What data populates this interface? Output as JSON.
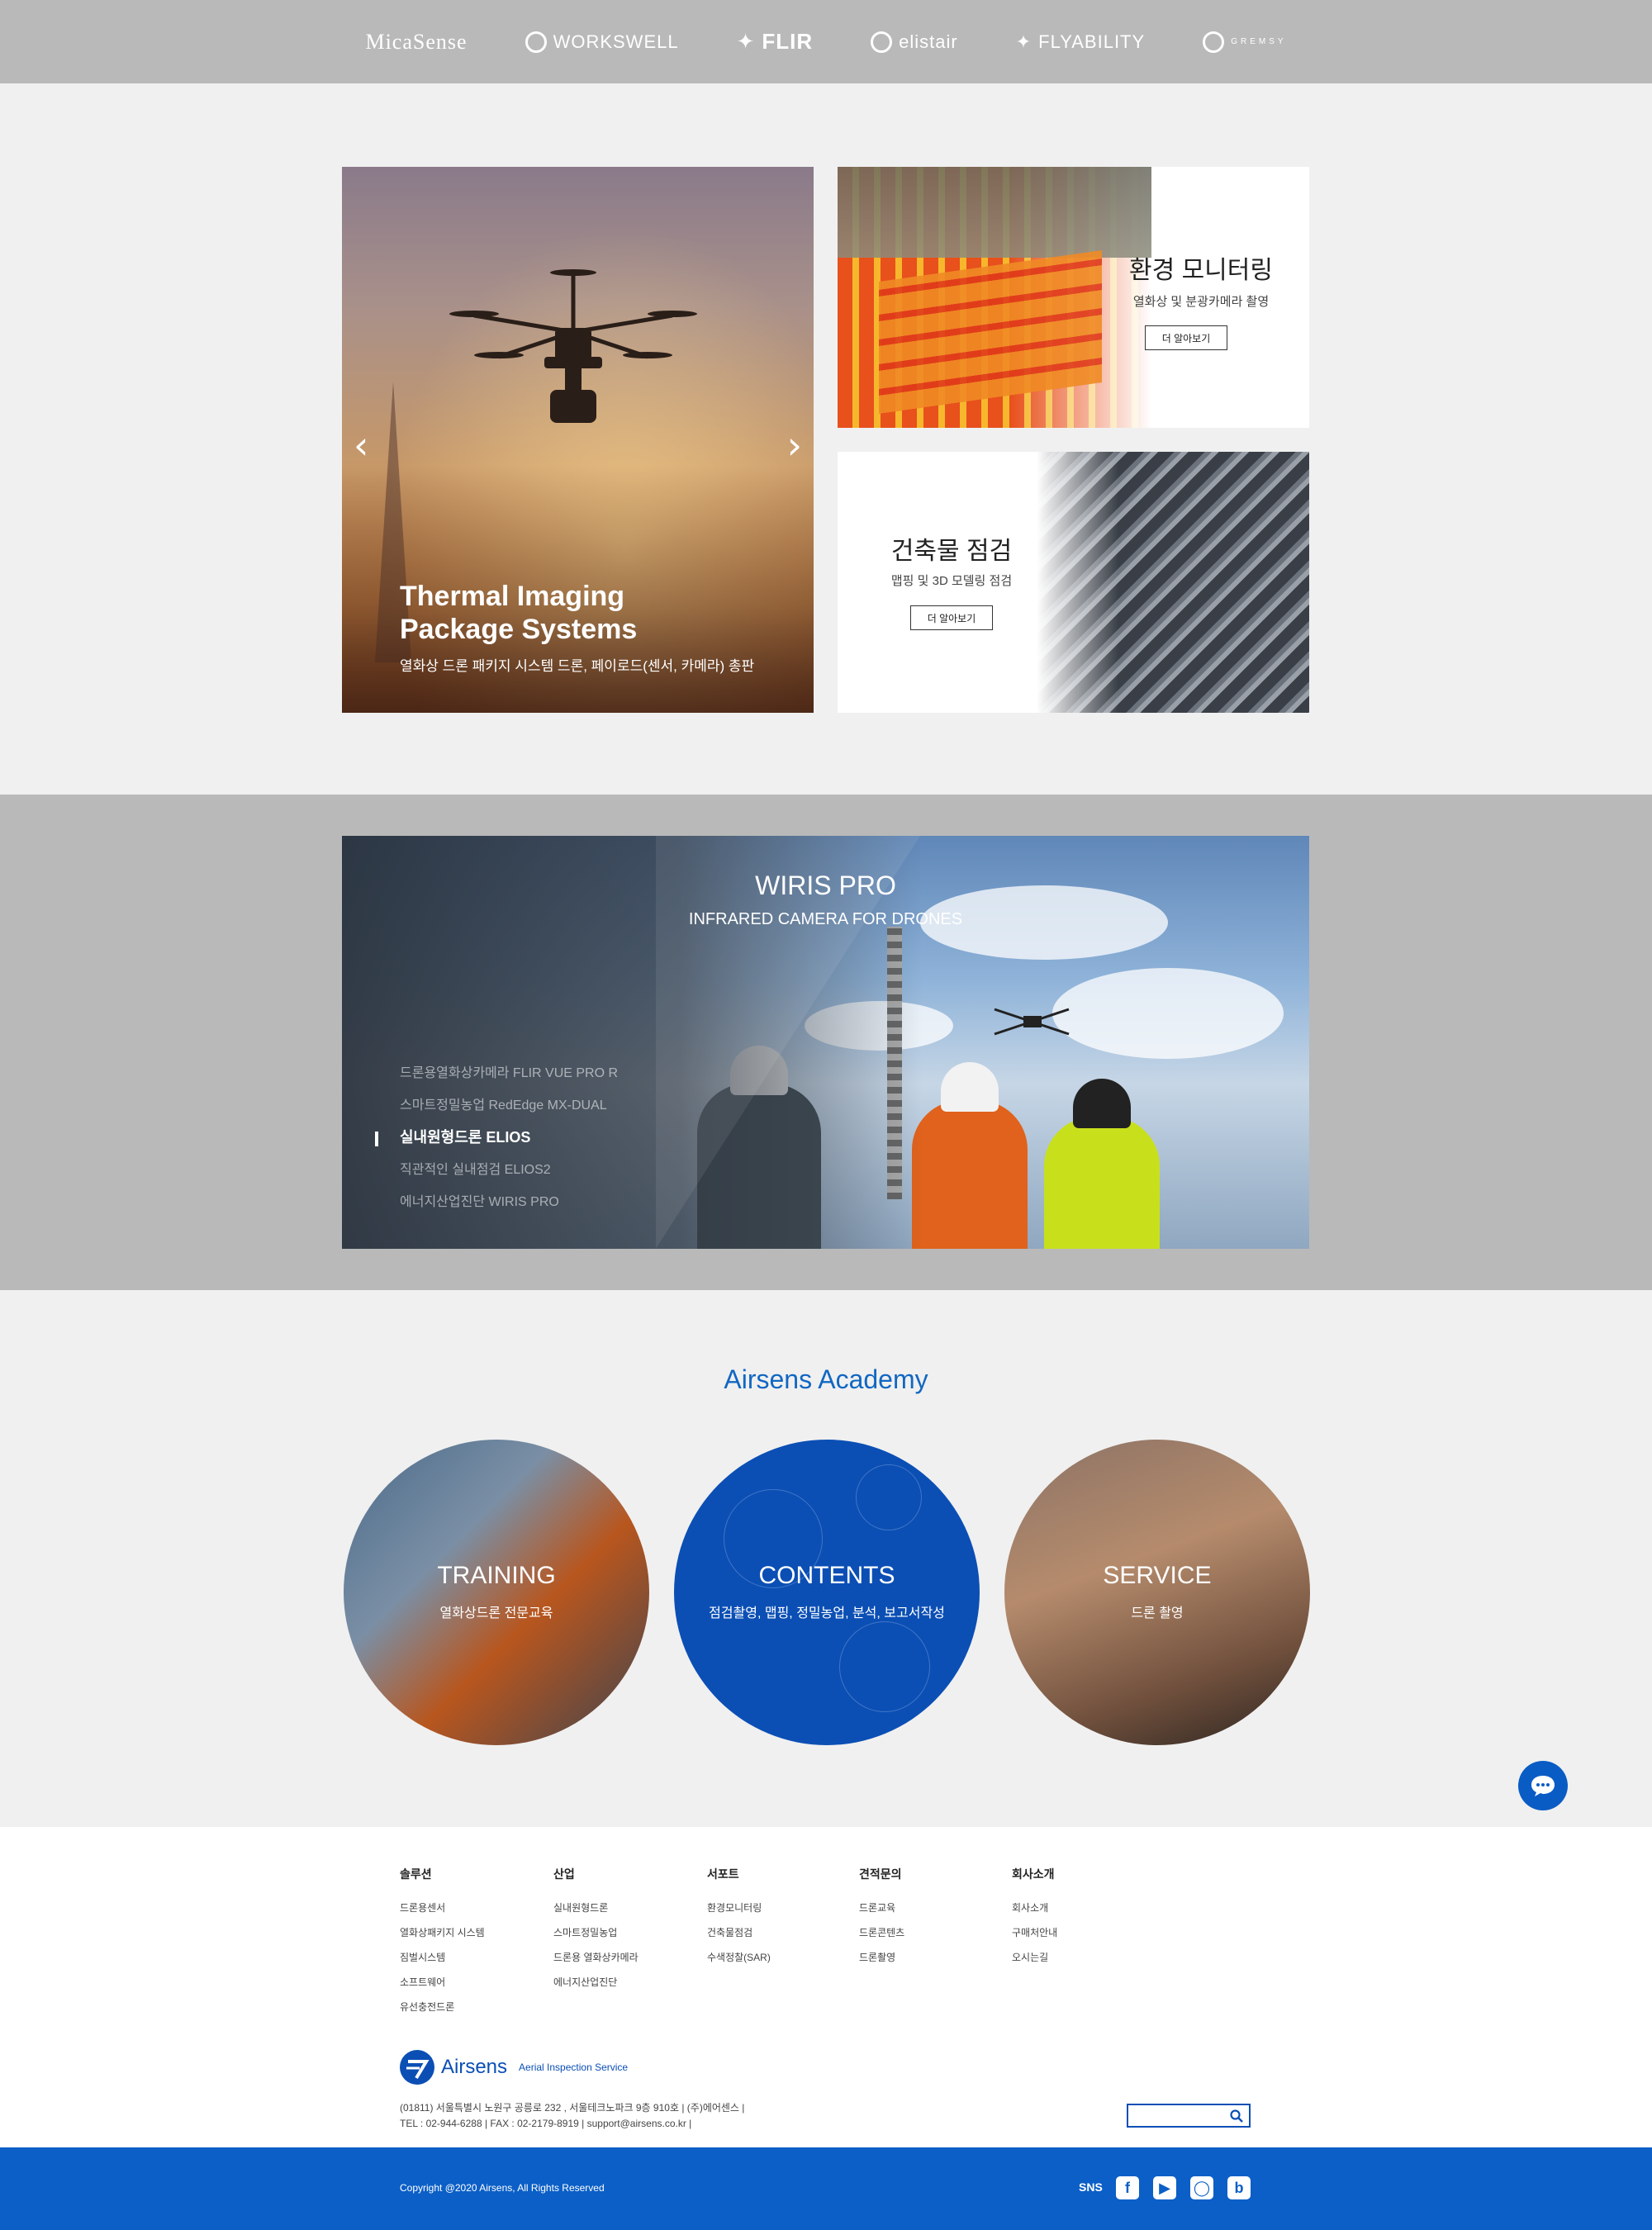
{
  "partners": [
    {
      "name": "MicaSense",
      "icon": "micasense-logo"
    },
    {
      "name": "WORKSWELL",
      "icon": "workswell-logo"
    },
    {
      "name": "FLIR",
      "icon": "flir-logo"
    },
    {
      "name": "elistair",
      "icon": "elistair-logo"
    },
    {
      "name": "FLYABILITY",
      "icon": "flyability-logo"
    },
    {
      "name": "GREMSY",
      "icon": "gremsy-logo"
    }
  ],
  "hero": {
    "slide": {
      "title_line1": "Thermal Imaging",
      "title_line2": "Package Systems",
      "subtitle": "열화상 드론 패키지 시스템 드론, 페이로드(센서, 카메라) 총판"
    },
    "prev_icon": "chevron-left-icon",
    "next_icon": "chevron-right-icon"
  },
  "cards": {
    "environment": {
      "title": "환경 모니터링",
      "desc": "열화상 및 분광카메라 촬영",
      "button": "더 알아보기"
    },
    "building": {
      "title": "건축물 점검",
      "desc": "맵핑 및 3D 모델링 점검",
      "button": "더 알아보기"
    }
  },
  "product_banner": {
    "title": "WIRIS PRO",
    "subtitle": "INFRARED CAMERA FOR DRONES",
    "menu": [
      "드론용열화상카메라 FLIR VUE PRO R",
      "스마트정밀농업 RedEdge MX-DUAL",
      "실내원형드론 ELIOS",
      "직관적인 실내점검 ELIOS2",
      "에너지산업진단 WIRIS PRO"
    ],
    "active_index": 2
  },
  "academy": {
    "title": "Airsens  Academy",
    "items": [
      {
        "title": "TRAINING",
        "subtitle": "열화상드론 전문교육"
      },
      {
        "title": "CONTENTS",
        "subtitle": "점검촬영, 맵핑, 정밀농업, 분석, 보고서작성"
      },
      {
        "title": "SERVICE",
        "subtitle": "드론 촬영"
      }
    ]
  },
  "chat": {
    "icon": "chat-bubble-icon"
  },
  "footer": {
    "columns": [
      {
        "heading": "솔루션",
        "links": [
          "드론용센서",
          "열화상패키지 시스템",
          "짐벌시스템",
          "소프트웨어",
          "유선충전드론"
        ]
      },
      {
        "heading": "산업",
        "links": [
          "실내원형드론",
          "스마트정밀농업",
          "드론용 열화상카메라",
          "에너지산업진단"
        ]
      },
      {
        "heading": "서포트",
        "links": [
          "환경모니터링",
          "건축물점검",
          "수색정찰(SAR)"
        ]
      },
      {
        "heading": "견적문의",
        "links": [
          "드론교육",
          "드론콘텐츠",
          "드론촬영"
        ]
      },
      {
        "heading": "회사소개",
        "links": [
          "회사소개",
          "구매처안내",
          "오시는길"
        ]
      }
    ],
    "logo_name": "Airsens",
    "logo_tagline": "Aerial Inspection Service",
    "address_line1": "(01811) 서울특별시 노원구 공릉로 232 , 서울테크노파크 9층 910호  |   (주)에어센스  |",
    "address_line2": "TEL : 02-944-6288  |  FAX : 02-2179-8919  |  support@airsens.co.kr  |",
    "search_placeholder": "",
    "search_icon": "search-icon",
    "copyright": "Copyright @2020 Airsens, All Rights Reserved",
    "sns_label": "SNS",
    "sns_icons": [
      "facebook-icon",
      "youtube-icon",
      "instagram-icon",
      "blog-icon"
    ]
  },
  "colors": {
    "brand_blue": "#0b5fc7",
    "accent_blue": "#1167c2",
    "partner_bar": "#b9b9b9",
    "page_bg": "#f0f0f0"
  }
}
